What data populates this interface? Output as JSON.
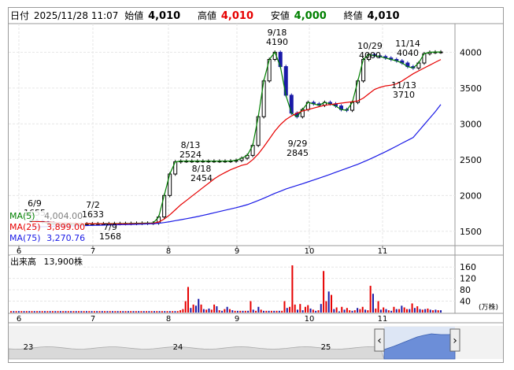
{
  "header": {
    "date_label": "日付",
    "date_value": "2025/11/28 11:07",
    "open_label": "始値",
    "open_value": "4,010",
    "high_label": "高値",
    "high_value": "4,010",
    "low_label": "安値",
    "low_value": "4,000",
    "close_label": "終値",
    "close_value": "4,010"
  },
  "legend": {
    "ma5_label": "MA(5)",
    "ma5_value": "4,004.00",
    "ma25_label": "MA(25)",
    "ma25_value": "3,899.00",
    "ma75_label": "MA(75)",
    "ma75_value": "3,270.76"
  },
  "volume_panel": {
    "title": "出来高",
    "value": "13,900株",
    "unit": "(万株)"
  },
  "colors": {
    "up": "#e60000",
    "down": "#1a1aa8",
    "ma5": "#008000",
    "ma25": "#e60000",
    "ma75": "#1a1ae6"
  },
  "chart_data": [
    {
      "type": "candlestick",
      "x_axis": {
        "labels": [
          "6",
          "7",
          "8",
          "9",
          "10",
          "11"
        ]
      },
      "y_axis": {
        "ticks": [
          1500,
          2000,
          2500,
          3000,
          3500,
          4000
        ],
        "range": [
          1300,
          4400
        ]
      },
      "annotations": [
        {
          "date": "6/9",
          "value": "1655"
        },
        {
          "date": "7/2",
          "value": "1633"
        },
        {
          "date": "7/9",
          "value": "1568"
        },
        {
          "date": "8/13",
          "value": "2524"
        },
        {
          "date": "8/18",
          "value": "2454"
        },
        {
          "date": "9/18",
          "value": "4190"
        },
        {
          "date": "9/29",
          "value": "2845"
        },
        {
          "date": "10/29",
          "value": "4000"
        },
        {
          "date": "11/14",
          "value": "4040"
        },
        {
          "date": "11/13",
          "value": "3710"
        }
      ],
      "series": [
        {
          "name": "MA(5)",
          "values": [
            1650,
            1640,
            1630,
            1610,
            1605,
            1600,
            1598,
            1600,
            1600,
            1601,
            1603,
            1605,
            1606,
            1606,
            1607,
            1608,
            1608,
            1609,
            1610,
            1612,
            1613,
            1614,
            1616,
            1700,
            2000,
            2300,
            2470,
            2480,
            2480,
            2480,
            2480,
            2480,
            2480,
            2480,
            2480,
            2480,
            2482,
            2490,
            2520,
            2560,
            2700,
            3100,
            3600,
            3900,
            4000,
            3800,
            3400,
            3150,
            3100,
            3200,
            3300,
            3280,
            3260,
            3300,
            3280,
            3250,
            3200,
            3190,
            3300,
            3600,
            3900,
            3970,
            3950,
            3940,
            3920,
            3900,
            3880,
            3850,
            3800,
            3780,
            3850,
            3980,
            4000,
            4003,
            4004
          ]
        },
        {
          "name": "MA(25)",
          "values": [
            1640,
            1636,
            1632,
            1628,
            1624,
            1620,
            1617,
            1614,
            1612,
            1610,
            1608,
            1607,
            1606,
            1606,
            1606,
            1606,
            1606,
            1606,
            1606,
            1607,
            1608,
            1610,
            1612,
            1630,
            1670,
            1730,
            1800,
            1870,
            1930,
            1990,
            2050,
            2110,
            2170,
            2230,
            2280,
            2320,
            2360,
            2390,
            2420,
            2440,
            2500,
            2580,
            2680,
            2790,
            2900,
            2990,
            3060,
            3110,
            3150,
            3180,
            3200,
            3220,
            3240,
            3260,
            3270,
            3280,
            3290,
            3300,
            3310,
            3320,
            3360,
            3420,
            3480,
            3510,
            3530,
            3540,
            3560,
            3600,
            3650,
            3700,
            3740,
            3780,
            3820,
            3860,
            3899
          ]
        },
        {
          "name": "MA(75)",
          "values": [
            1560,
            1562,
            1564,
            1566,
            1568,
            1570,
            1572,
            1574,
            1576,
            1578,
            1580,
            1582,
            1584,
            1586,
            1588,
            1590,
            1592,
            1594,
            1596,
            1598,
            1600,
            1603,
            1606,
            1612,
            1622,
            1634,
            1648,
            1662,
            1676,
            1690,
            1706,
            1722,
            1740,
            1758,
            1776,
            1794,
            1812,
            1830,
            1850,
            1872,
            1900,
            1930,
            1962,
            1996,
            2030,
            2060,
            2090,
            2116,
            2140,
            2164,
            2190,
            2216,
            2242,
            2268,
            2296,
            2324,
            2352,
            2380,
            2408,
            2436,
            2468,
            2502,
            2538,
            2574,
            2610,
            2650,
            2690,
            2730,
            2770,
            2810,
            2900,
            2990,
            3080,
            3170,
            3270
          ]
        }
      ]
    },
    {
      "type": "bar",
      "title": "出来高",
      "y_axis": {
        "ticks": [
          40,
          80,
          120,
          160
        ],
        "unit": "(万株)"
      },
      "x_axis": {
        "labels": [
          "6",
          "7",
          "8",
          "9",
          "10",
          "11"
        ]
      },
      "values": [
        5,
        5,
        5,
        5,
        5,
        5,
        5,
        5,
        5,
        5,
        5,
        5,
        5,
        5,
        5,
        5,
        5,
        5,
        5,
        5,
        5,
        5,
        5,
        5,
        5,
        5,
        5,
        5,
        5,
        5,
        5,
        5,
        5,
        5,
        5,
        5,
        5,
        5,
        5,
        5,
        5,
        5,
        5,
        5,
        5,
        5,
        5,
        5,
        5,
        5,
        5,
        5,
        5,
        5,
        5,
        5,
        5,
        5,
        5,
        5,
        5,
        5,
        5,
        5,
        5,
        8,
        12,
        40,
        90,
        16,
        28,
        24,
        48,
        28,
        12,
        10,
        14,
        10,
        28,
        22,
        8,
        6,
        12,
        20,
        12,
        8,
        6,
        6,
        6,
        6,
        6,
        6,
        40,
        10,
        6,
        20,
        10,
        6,
        6,
        6,
        6,
        6,
        6,
        6,
        6,
        40,
        16,
        20,
        166,
        28,
        10,
        30,
        8,
        20,
        26,
        14,
        10,
        6,
        8,
        30,
        146,
        40,
        74,
        62,
        12,
        18,
        4,
        20,
        10,
        16,
        8,
        6,
        8,
        16,
        12,
        20,
        10,
        8,
        94,
        66,
        14,
        40,
        10,
        18,
        12,
        8,
        6,
        20,
        12,
        12,
        24,
        18,
        12,
        12,
        32,
        16,
        22,
        12,
        10,
        12,
        14,
        10,
        8,
        10,
        8,
        8
      ],
      "up": [
        true,
        false,
        true,
        false,
        true,
        false,
        true,
        false,
        true,
        false,
        true,
        false,
        true,
        false,
        true,
        false,
        true,
        false,
        true,
        false,
        true,
        false,
        true,
        false,
        true,
        false,
        true,
        false,
        true,
        false,
        true,
        false,
        true,
        false,
        true,
        false,
        true,
        false,
        true,
        false,
        true,
        false,
        true,
        false,
        true,
        false,
        true,
        false,
        true,
        false,
        true,
        false,
        true,
        false,
        true,
        false,
        true,
        false,
        true,
        false,
        true,
        false,
        true,
        false,
        true,
        true,
        true,
        true,
        true,
        false,
        true,
        false,
        false,
        true,
        false,
        true,
        false,
        true,
        true,
        false,
        true,
        false,
        true,
        false,
        true,
        false,
        true,
        false,
        true,
        false,
        true,
        false,
        true,
        false,
        true,
        false,
        true,
        false,
        true,
        false,
        true,
        false,
        true,
        false,
        true,
        true,
        false,
        true,
        true,
        true,
        false,
        true,
        false,
        true,
        true,
        false,
        true,
        false,
        true,
        false,
        true,
        true,
        false,
        true,
        false,
        true,
        false,
        true,
        false,
        true,
        true,
        false,
        true,
        false,
        true,
        true,
        false,
        true,
        true,
        false,
        true,
        true,
        false,
        true,
        false,
        true,
        false,
        true,
        false,
        true,
        false,
        true,
        true,
        false,
        true,
        false,
        true,
        false,
        true,
        false,
        true,
        false,
        true,
        false,
        true,
        false
      ]
    }
  ],
  "navigator": {
    "labels": [
      "23",
      "24",
      "25"
    ],
    "left_handle_icon": "chevron-left-icon",
    "right_handle_icon": "chevron-right-icon"
  }
}
